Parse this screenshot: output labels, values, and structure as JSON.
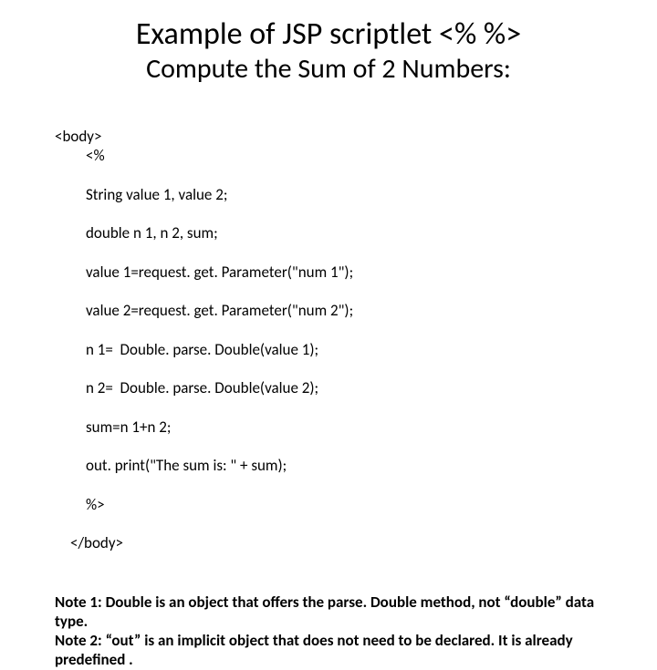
{
  "title": "Example of JSP scriptlet <%   %>",
  "subtitle": "Compute the Sum of 2 Numbers:",
  "code": {
    "open_tag": "<body>",
    "l1": "<%",
    "l2": "String value 1, value 2;",
    "l3": "double n 1, n 2, sum;",
    "l4": "value 1=request. get. Parameter(\"num 1\");",
    "l5": "value 2=request. get. Parameter(\"num 2\");",
    "l6": "n 1=  Double. parse. Double(value 1);",
    "l7": "n 2=  Double. parse. Double(value 2);",
    "l8": "sum=n 1+n 2;",
    "l9": "out. print(\"The sum is: \" + sum);",
    "l10": "%>",
    "close_tag": "</body>"
  },
  "notes": {
    "n1": "Note 1: Double is an object that offers the parse. Double method, not “double” data type.",
    "n2": "Note 2: “out”  is an implicit object that does not need to be declared.  It is already predefined ."
  }
}
